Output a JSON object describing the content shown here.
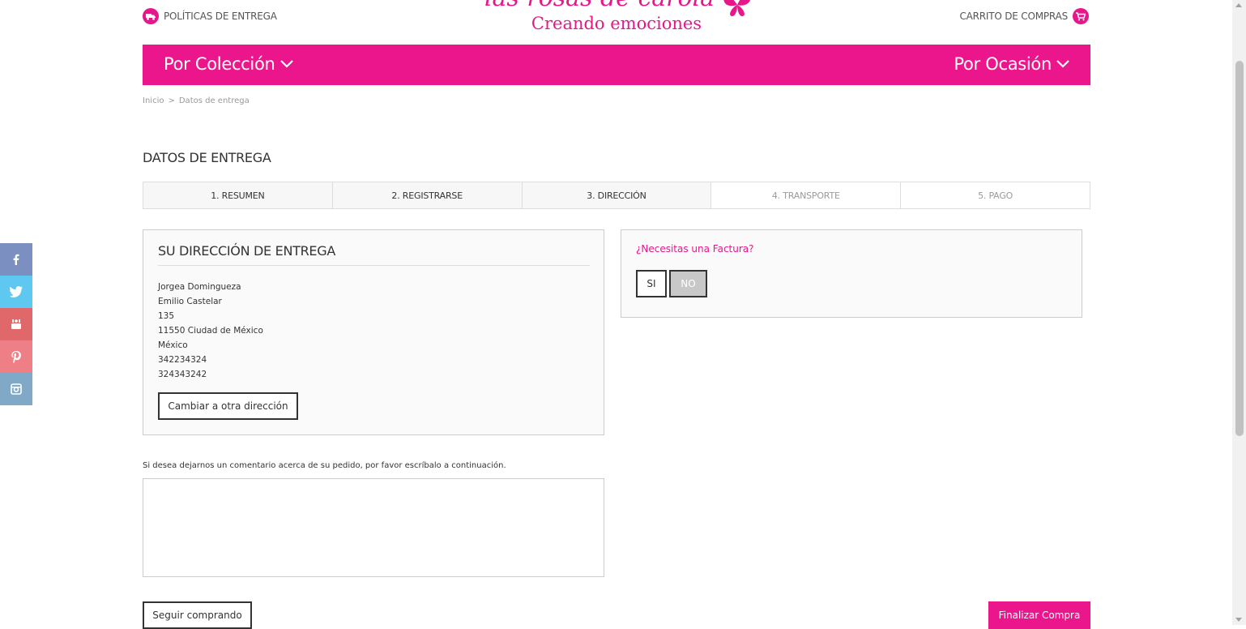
{
  "header": {
    "delivery_policies": "POLÍTICAS DE ENTREGA",
    "cart": "CARRITO DE COMPRAS",
    "logo_script": "las rosas de carola",
    "logo_tagline": "Creando emociones",
    "brand_color": "#ec168c"
  },
  "nav": {
    "by_collection": "Por Colección",
    "by_occasion": "Por Ocasión"
  },
  "breadcrumb": {
    "home": "Inicio",
    "separator": ">",
    "current": "Datos de entrega"
  },
  "page_title": "DATOS DE ENTREGA",
  "steps": [
    {
      "label": "1. RESUMEN",
      "state": "done"
    },
    {
      "label": "2. REGISTRARSE",
      "state": "done"
    },
    {
      "label": "3. DIRECCIÓN",
      "state": "current"
    },
    {
      "label": "4. TRANSPORTE",
      "state": "todo"
    },
    {
      "label": "5. PAGO",
      "state": "todo"
    }
  ],
  "address": {
    "title": "SU DIRECCIÓN DE ENTREGA",
    "lines": [
      "Jorgea Domingueza",
      "Emilio Castelar",
      "135",
      "11550 Ciudad de México",
      "México",
      "342234324",
      "324343242"
    ],
    "change_button": "Cambiar a otra dirección"
  },
  "invoice": {
    "question": "¿Necesitas una Factura?",
    "yes": "SI",
    "no": "NO",
    "selected": "NO"
  },
  "comment": {
    "label": "Si desea dejarnos un comentario acerca de su pedido, por favor escríbalo a continuación.",
    "value": ""
  },
  "actions": {
    "continue_shopping": "Seguir comprando",
    "finish_purchase": "Finalizar Compra"
  },
  "social": [
    {
      "icon": "facebook-icon",
      "glyph": "f",
      "color": "#7b8fc0"
    },
    {
      "icon": "twitter-icon",
      "glyph": "t",
      "color": "#5fc8f0"
    },
    {
      "icon": "youtube-icon",
      "glyph": "▶",
      "color": "#e0686a"
    },
    {
      "icon": "pinterest-icon",
      "glyph": "p",
      "color": "#ee7f86"
    },
    {
      "icon": "instagram-icon",
      "glyph": "◎",
      "color": "#7fa9c7"
    }
  ]
}
